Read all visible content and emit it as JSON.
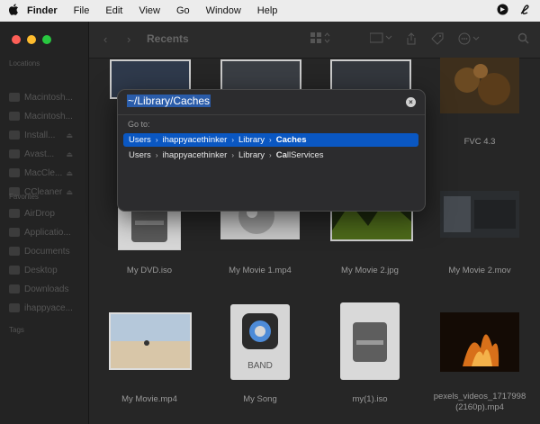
{
  "menubar": {
    "apple": "",
    "items": [
      "Finder",
      "File",
      "Edit",
      "View",
      "Go",
      "Window",
      "Help"
    ]
  },
  "sidebar": {
    "locations_header": "Locations",
    "locations": [
      {
        "label": "Macintosh..."
      },
      {
        "label": "Macintosh..."
      },
      {
        "label": "Install..."
      },
      {
        "label": "Avast..."
      },
      {
        "label": "MacCle..."
      },
      {
        "label": "CCleaner"
      }
    ],
    "favorites_header": "Favorites",
    "favorites": [
      {
        "label": "AirDrop"
      },
      {
        "label": "Applicatio..."
      },
      {
        "label": "Documents"
      },
      {
        "label": "Desktop"
      },
      {
        "label": "Downloads"
      },
      {
        "label": "ihappyace..."
      }
    ],
    "tags_header": "Tags"
  },
  "toolbar": {
    "back": "‹",
    "forward": "›",
    "title": "Recents"
  },
  "files": [
    {
      "name": "FVC 4.3"
    },
    {
      "name": "My DVD.iso"
    },
    {
      "name": "My Movie 1.mp4"
    },
    {
      "name": "My Movie 2.jpg"
    },
    {
      "name": "My Movie 2.mov"
    },
    {
      "name": "My Movie.mp4"
    },
    {
      "name": "My Song"
    },
    {
      "name": "my(1).iso"
    },
    {
      "name": "pexels_videos_1717998"
    },
    {
      "name": "(2160p).mp4"
    }
  ],
  "song_badge": "BAND",
  "goto_dialog": {
    "path_value": "~/Library/Caches",
    "clear_glyph": "×",
    "section_label": "Go to:",
    "suggestions": [
      {
        "parts": [
          "Users",
          "ihappyacethinker",
          "Library"
        ],
        "last": "Caches",
        "selected": true
      },
      {
        "parts": [
          "Users",
          "ihappyacethinker",
          "Library"
        ],
        "last_prefix": "Ca",
        "last_rest": "llServices",
        "selected": false
      }
    ],
    "chevron": "›"
  }
}
